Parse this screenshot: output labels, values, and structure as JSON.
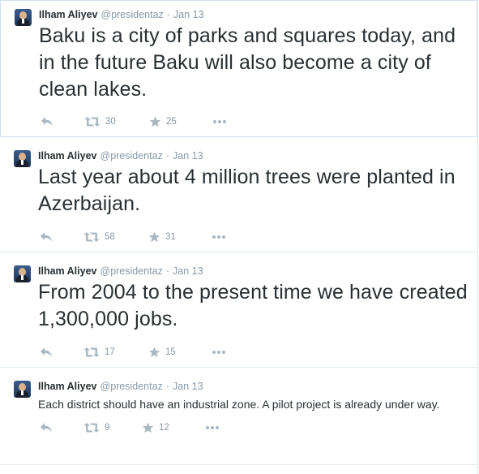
{
  "user": {
    "name": "Ilham Aliyev",
    "handle": "@presidentaz",
    "separator": "·"
  },
  "tweets": [
    {
      "date": "Jan 13",
      "text": "Baku is a city of parks and squares today, and in the future Baku will also become a city of clean lakes.",
      "retweets": "30",
      "favorites": "25"
    },
    {
      "date": "Jan 13",
      "text": "Last year about 4 million trees were planted in Azerbaijan.",
      "retweets": "58",
      "favorites": "31"
    },
    {
      "date": "Jan 13",
      "text": "From 2004 to the present time we have created 1,300,000 jobs.",
      "retweets": "17",
      "favorites": "15"
    },
    {
      "date": "Jan 13",
      "text": "Each district should have an industrial zone. A pilot project is already under way.",
      "retweets": "9",
      "favorites": "12"
    }
  ],
  "icons": {
    "reply": "reply-icon",
    "retweet": "retweet-icon",
    "favorite": "star-icon",
    "more": "more-icon"
  },
  "colors": {
    "text": "#292f33",
    "muted": "#8899a6",
    "divider": "#e1e8ed"
  }
}
